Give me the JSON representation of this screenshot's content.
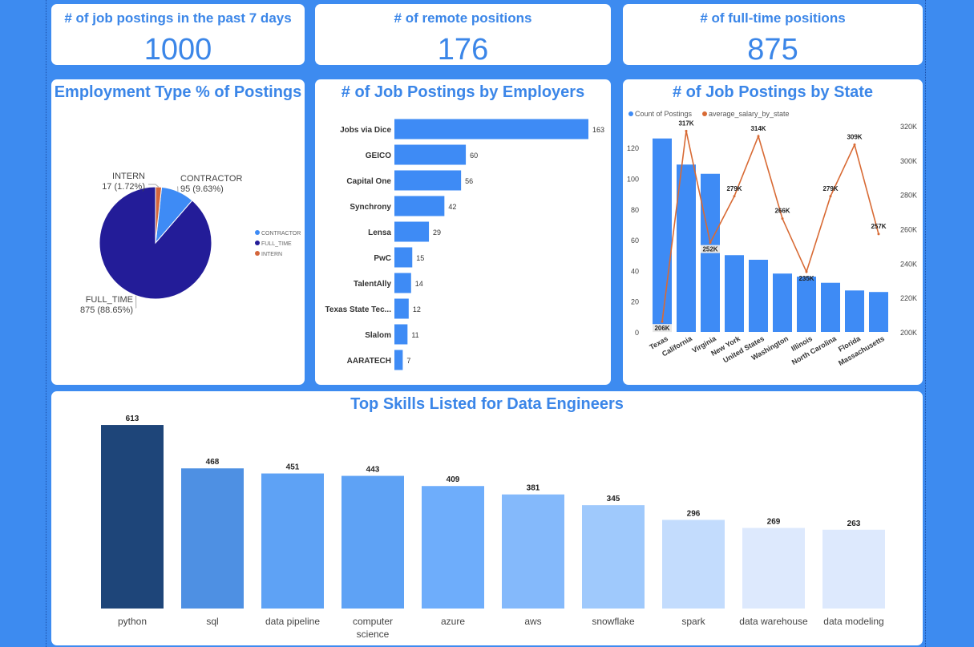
{
  "kpis": {
    "postings_7d": {
      "title": "# of job postings in the past 7 days",
      "value": "1000"
    },
    "remote": {
      "title": "# of remote positions",
      "value": "176"
    },
    "fulltime": {
      "title": "# of full-time positions",
      "value": "875"
    }
  },
  "colors": {
    "background": "#3d8bf0",
    "accent_text": "#3b86e8",
    "bar_blue": "#3e8bf5",
    "full_time": "#231c98",
    "contractor": "#3e8bf5",
    "intern": "#d4663c",
    "salary_line": "#d86a34"
  },
  "chart_data": [
    {
      "id": "employment",
      "type": "pie",
      "title": "Employment Type % of Postings",
      "slices": [
        {
          "label": "CONTRACTOR",
          "value": 95,
          "percent": "9.63%",
          "text": "95 (9.63%)",
          "color": "#3e8bf5"
        },
        {
          "label": "FULL_TIME",
          "value": 875,
          "percent": "88.65%",
          "text": "875 (88.65%)",
          "color": "#231c98"
        },
        {
          "label": "INTERN",
          "value": 17,
          "percent": "1.72%",
          "text": "17 (1.72%)",
          "color": "#d4663c"
        }
      ],
      "legend": [
        "CONTRACTOR",
        "FULL_TIME",
        "INTERN"
      ],
      "legend_position": "right"
    },
    {
      "id": "employers",
      "type": "bar",
      "orientation": "horizontal",
      "title": "# of Job Postings by Employers",
      "categories": [
        "Jobs via Dice",
        "GEICO",
        "Capital One",
        "Synchrony",
        "Lensa",
        "PwC",
        "TalentAlly",
        "Texas State Tec...",
        "Slalom",
        "AARATECH"
      ],
      "values": [
        163,
        60,
        56,
        42,
        29,
        15,
        14,
        12,
        11,
        7
      ]
    },
    {
      "id": "states",
      "type": "bar",
      "title": "# of Job Postings by State",
      "legend": [
        "Count of Postings",
        "average_salary_by_state"
      ],
      "legend_position": "top-left",
      "categories": [
        "Texas",
        "California",
        "Virginia",
        "New York",
        "United States",
        "Washington",
        "Illinois",
        "North Carolina",
        "Florida",
        "Massachusetts"
      ],
      "series": [
        {
          "name": "Count of Postings",
          "type": "bar",
          "axis": "left",
          "values": [
            126,
            109,
            103,
            50,
            47,
            38,
            36,
            32,
            27,
            26
          ]
        },
        {
          "name": "average_salary_by_state",
          "type": "line",
          "axis": "right",
          "values": [
            206000,
            317000,
            252000,
            279000,
            314000,
            266000,
            235000,
            279000,
            309000,
            257000
          ],
          "labels": [
            "206K",
            "317K",
            "252K",
            "279K",
            "314K",
            "266K",
            "235K",
            "279K",
            "309K",
            "257K"
          ]
        }
      ],
      "y_left": {
        "ylim": [
          0,
          130
        ],
        "ticks": [
          "0",
          "20",
          "40",
          "60",
          "80",
          "100",
          "120"
        ]
      },
      "y_right": {
        "ylim": [
          200000,
          320000
        ],
        "ticks": [
          "200K",
          "220K",
          "240K",
          "260K",
          "280K",
          "300K",
          "320K"
        ]
      }
    },
    {
      "id": "skills",
      "type": "bar",
      "title": "Top Skills Listed for Data Engineers",
      "categories": [
        "python",
        "sql",
        "data pipeline",
        "computer science",
        "azure",
        "aws",
        "snowflake",
        "spark",
        "data warehouse",
        "data modeling"
      ],
      "category_lines": [
        [
          "python"
        ],
        [
          "sql"
        ],
        [
          "data pipeline"
        ],
        [
          "computer",
          "science"
        ],
        [
          "azure"
        ],
        [
          "aws"
        ],
        [
          "snowflake"
        ],
        [
          "spark"
        ],
        [
          "data warehouse"
        ],
        [
          "data modeling"
        ]
      ],
      "values": [
        613,
        468,
        451,
        443,
        409,
        381,
        345,
        296,
        269,
        263
      ],
      "colors": [
        "#1e4579",
        "#4e90e3",
        "#5ea2f5",
        "#5ea2f5",
        "#6eadfb",
        "#84b9fb",
        "#9fc9fc",
        "#c3dcfd",
        "#dde9fd",
        "#dde9fd"
      ]
    }
  ]
}
